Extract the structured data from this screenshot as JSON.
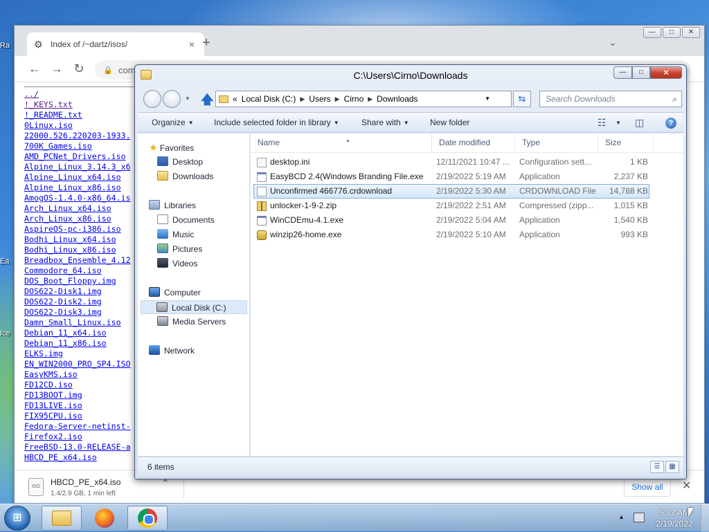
{
  "desktop": {
    "icon_labels": [
      "Ra",
      "Ea",
      "Ice"
    ]
  },
  "chrome": {
    "tab_title": "Index of /~dartz/isos/",
    "tab_close": "×",
    "new_tab": "+",
    "tab_list": "⌄",
    "win_min": "—",
    "win_max": "□",
    "win_close": "✕",
    "back": "←",
    "forward": "→",
    "reload": "↻",
    "address": "com",
    "listing": {
      "parent": "../",
      "files": [
        "!_KEYS.txt",
        "!_README.txt",
        "0Linux.iso",
        "22000.526.220203-1933.",
        "700K_Games.iso",
        "AMD_PCNet_Drivers.iso",
        "Alpine_Linux_3.14.3_x6",
        "Alpine_Linux_x64.iso",
        "Alpine_Linux_x86.iso",
        "AmogOS-1.4.0-x86_64.is",
        "Arch_Linux_x64.iso",
        "Arch_Linux_x86.iso",
        "AspireOS-pc-i386.iso",
        "Bodhi_Linux_x64.iso",
        "Bodhi_Linux_x86.iso",
        "Breadbox_Ensemble_4.12",
        "Commodore_64.iso",
        "DOS_Boot_Floppy.img",
        "DOS622-Disk1.img",
        "DOS622-Disk2.img",
        "DOS622-Disk3.img",
        "Damn_Small_Linux.iso",
        "Debian_11_x64.iso",
        "Debian_11_x86.iso",
        "ELKS.img",
        "EN_WIN2000_PRO_SP4.ISO",
        "EasyKMS.iso",
        "FD12CD.iso",
        "FD13BOOT.img",
        "FD13LIVE.iso",
        "FIX95CPU.iso",
        "Fedora-Server-netinst-",
        "Firefox2.iso",
        "FreeBSD-13.0-RELEASE-a",
        "HBCD_PE_x64.iso"
      ]
    },
    "download": {
      "filename": "HBCD_PE_x64.iso",
      "status": "1.4/2.9 GB, 1 min left",
      "icon_label": "ISO",
      "chevron": "⌃",
      "show_all": "Show all",
      "close": "✕"
    }
  },
  "explorer": {
    "title": "C:\\Users\\Cirno\\Downloads",
    "win_min": "—",
    "win_max": "□",
    "win_close": "✕",
    "nav_dropdown": "▼",
    "up": "🡅",
    "breadcrumb": [
      "Local Disk (C:)",
      "Users",
      "Cirno",
      "Downloads"
    ],
    "crumb_lead": "«",
    "crumb_sep": "▶",
    "addr_dropdown": "▼",
    "refresh": "⇆",
    "search_placeholder": "Search Downloads",
    "search_icon": "⌕",
    "commands": {
      "organize": "Organize",
      "include": "Include selected folder in library",
      "share": "Share with",
      "new_folder": "New folder",
      "caret": "▼",
      "views_icon": "☷",
      "preview_icon": "◫",
      "help_icon": "?"
    },
    "nav": {
      "favorites": "Favorites",
      "desktop": "Desktop",
      "downloads": "Downloads",
      "libraries": "Libraries",
      "documents": "Documents",
      "music": "Music",
      "pictures": "Pictures",
      "videos": "Videos",
      "computer": "Computer",
      "local_disk": "Local Disk (C:)",
      "media_servers": "Media Servers",
      "network": "Network",
      "star": "★"
    },
    "columns": {
      "name": "Name",
      "date": "Date modified",
      "type": "Type",
      "size": "Size",
      "sort": "▲"
    },
    "files": [
      {
        "name": "desktop.ini",
        "date": "12/11/2021 10:47 ...",
        "type": "Configuration sett...",
        "size": "1 KB",
        "icon": "ini"
      },
      {
        "name": "EasyBCD 2.4(Windows Branding File.exe",
        "date": "2/19/2022 5:19 AM",
        "type": "Application",
        "size": "2,237 KB",
        "icon": "exe"
      },
      {
        "name": "Unconfirmed 466776.crdownload",
        "date": "2/19/2022 5:30 AM",
        "type": "CRDOWNLOAD File",
        "size": "14,788 KB",
        "icon": "doc",
        "selected": true
      },
      {
        "name": "unlocker-1-9-2.zip",
        "date": "2/19/2022 2:51 AM",
        "type": "Compressed (zipp...",
        "size": "1,015 KB",
        "icon": "zip"
      },
      {
        "name": "WinCDEmu-4.1.exe",
        "date": "2/19/2022 5:04 AM",
        "type": "Application",
        "size": "1,540 KB",
        "icon": "exe"
      },
      {
        "name": "winzip26-home.exe",
        "date": "2/19/2022 5:10 AM",
        "type": "Application",
        "size": "993 KB",
        "icon": "winzip"
      }
    ],
    "status": "6 items",
    "view_details_icon": "☰",
    "view_icons_icon": "▦"
  },
  "taskbar": {
    "start_icon": "⊞",
    "time": "5:32 AM",
    "date": "2/19/2022",
    "tray_arrow": "▲"
  }
}
